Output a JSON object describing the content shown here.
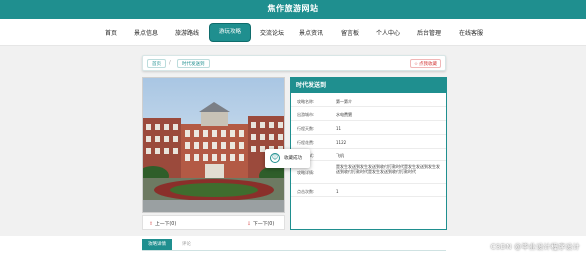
{
  "site": {
    "title": "焦作旅游网站"
  },
  "nav": {
    "items": [
      "首页",
      "景点信息",
      "旅游路线",
      "游玩攻略",
      "交流论坛",
      "景点资讯",
      "留言板",
      "个人中心",
      "后台管理",
      "在线客服"
    ],
    "active_index": 3
  },
  "breadcrumb": {
    "home": "首页",
    "current": "时代发送到",
    "separator": "/"
  },
  "favorite_button": {
    "label": "点我收藏"
  },
  "detail": {
    "title": "时代发送到",
    "fields": [
      {
        "label": "攻略名称:",
        "value": "第一第介"
      },
      {
        "label": "出游城市:",
        "value": "水电费猥"
      },
      {
        "label": "行程天数:",
        "value": "11"
      },
      {
        "label": "行程花费:",
        "value": "1122"
      },
      {
        "label": "交通方式:",
        "value": "飞机"
      },
      {
        "label": "攻略详情:",
        "value": "是发生发送到发生发送到收付打款时代是发生发送到发生发送到收付打款时代是发生发送到收付打款时代"
      },
      {
        "label": "点击次数:",
        "value": "1"
      }
    ]
  },
  "pager": {
    "prev": "上一下(0)",
    "next": "下一下(0)"
  },
  "toast": {
    "message": "收藏成功"
  },
  "tabs": {
    "items": [
      "攻略详情",
      "评论"
    ],
    "active_index": 0
  },
  "watermark": "CSDN @毕业设计程序设计",
  "colors": {
    "accent": "#1f8f8f",
    "favorite": "#d43b3b"
  }
}
